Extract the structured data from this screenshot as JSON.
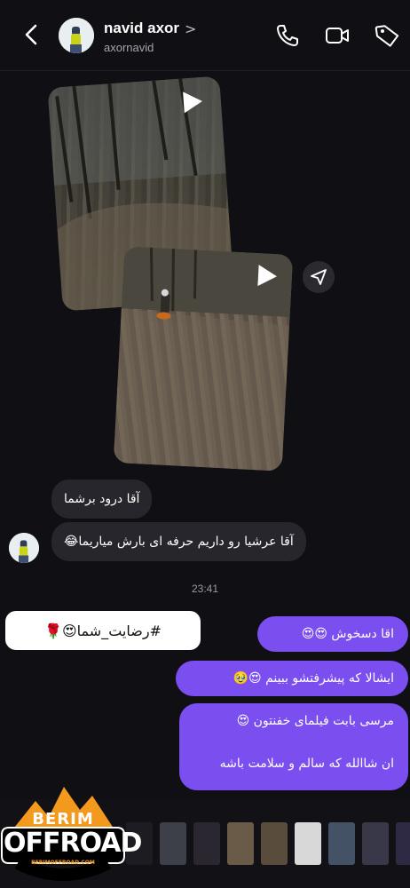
{
  "header": {
    "name": "navid axor",
    "chevron": ">",
    "username": "axornavid"
  },
  "icons": {
    "back": "back-arrow-icon",
    "phone": "phone-icon",
    "video": "video-camera-icon",
    "tag": "tag-icon",
    "share": "share-send-icon",
    "play": "play-icon"
  },
  "messages": {
    "incoming_1": "آقا درود برشما",
    "incoming_2": "آقا عرشیا رو داریم حرفه ای بارش میاریما😂",
    "timestamp": "23:41",
    "reply_tag": "#رضایت_شما😍🌹",
    "outgoing_1": "اقا دسخوش 😍😍",
    "outgoing_2": "ایشالا که پیشرفتشو ببینم 😍🥹",
    "outgoing_3_line1": "مرسی بابت فیلمای خفنتون 😍",
    "outgoing_3_line2": "ان شاالله که سالم و سلامت باشه"
  },
  "logo": {
    "line1": "BERIM",
    "line2": "OFFROAD",
    "url": "BERIMOFFROAD.COM"
  },
  "colors": {
    "background": "#0f0f14",
    "incoming_bubble": "#26262c",
    "outgoing_bubble": "#7b4ef0",
    "logo_accent": "#f39a1e"
  }
}
